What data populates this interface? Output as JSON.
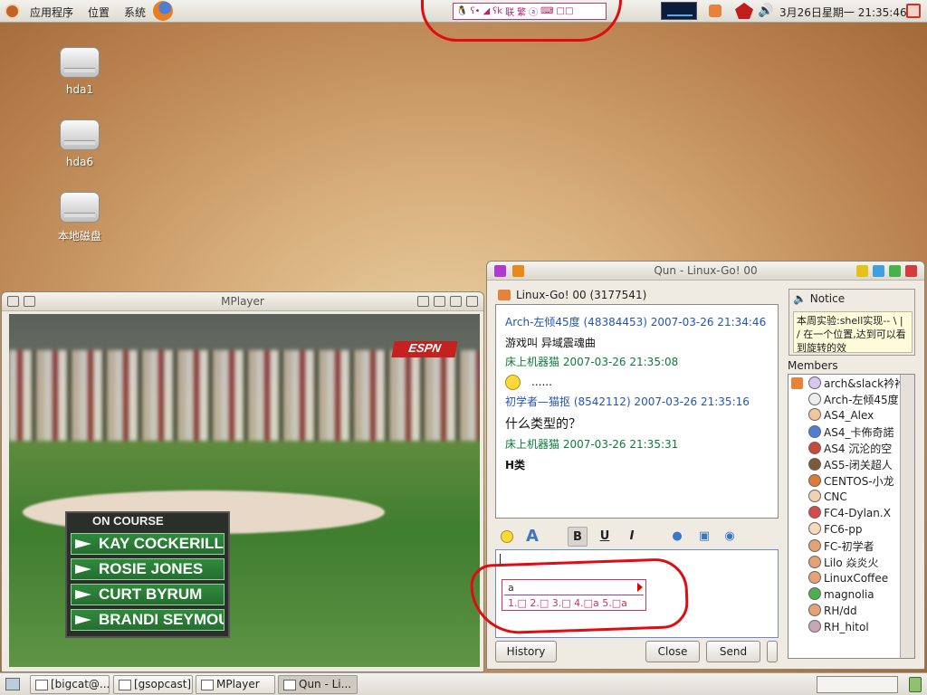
{
  "top_panel": {
    "menus": [
      "应用程序",
      "位置",
      "系统"
    ],
    "clock": "3月26日星期一 21:35:46"
  },
  "ime_toolbar": [
    "🐧",
    "ʕ•",
    "◢",
    "ʕk",
    "联",
    "繁",
    "ⓐ",
    "⌨",
    "□□"
  ],
  "desktop_icons": [
    "hda1",
    "hda6",
    "本地磁盘"
  ],
  "mplayer": {
    "title": "MPlayer",
    "broadcast_logo": "ESPN",
    "overlay_header": "ON COURSE",
    "overlay_rows": [
      "KAY COCKERILL",
      "ROSIE JONES",
      "CURT BYRUM",
      "BRANDI SEYMOUR"
    ]
  },
  "qun": {
    "title": "Qun - Linux-Go! 00",
    "group": "Linux-Go! 00 (3177541)",
    "messages": [
      {
        "header": "Arch-左倾45度 (48384453) 2007-03-26 21:34:46",
        "body": "游戏叫 异域震魂曲"
      },
      {
        "header": "床上机器猫 2007-03-26 21:35:08",
        "body": "......"
      },
      {
        "header": "初学者—猫抠 (8542112) 2007-03-26 21:35:16",
        "body": "什么类型的？"
      },
      {
        "header": "床上机器猫 2007-03-26 21:35:31",
        "body": "H类"
      }
    ],
    "toolbar": {
      "bold": "B",
      "underline": "U",
      "italic": "I"
    },
    "ime_popup": {
      "composition": "a",
      "candidates": "1.□ 2.□ 3.□ 4.□a 5.□a"
    },
    "buttons": {
      "history": "History",
      "close": "Close",
      "send": "Send"
    },
    "notice": {
      "title": "Notice",
      "text": "本周实验:shell实现-- \\ | / 在一个位置,达到可以看到旋转的效"
    },
    "members_label": "Members",
    "members": [
      "arch&slack衿衿",
      "Arch-左倾45度",
      "AS4_Alex",
      "AS4_卡佈奇諾",
      "AS4 沉沦的空",
      "AS5-闭关超人",
      "CENTOS-小龙",
      "CNC",
      "FC4-Dylan.X",
      "FC6-pp",
      "FC-初学者",
      "Lilo 焱炎火",
      "LinuxCoffee",
      "magnolia",
      "RH/dd",
      "RH_hitol"
    ]
  },
  "taskbar": [
    "[bigcat@...",
    "[gsopcast]",
    "MPlayer",
    "Qun - Li..."
  ]
}
